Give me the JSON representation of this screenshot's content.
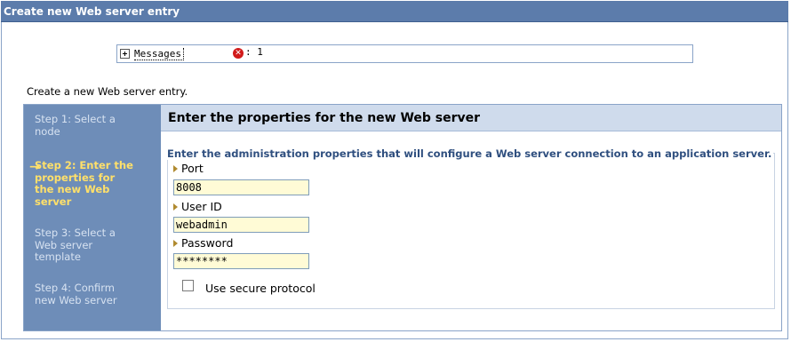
{
  "window": {
    "title": "Create new Web server entry"
  },
  "messages": {
    "label": "Messages",
    "error_count": ": 1",
    "error_icon": "error-x-icon"
  },
  "intro_text": "Create a new Web server entry.",
  "steps": [
    {
      "label": "Step 1: Select a node",
      "current": false
    },
    {
      "label": "Step 2: Enter the properties for the new Web server",
      "current": true
    },
    {
      "label": "Step 3: Select a Web server template",
      "current": false
    },
    {
      "label": "Step 4: Confirm new Web server",
      "current": false
    }
  ],
  "current_step_marker": "→",
  "content": {
    "heading": "Enter the properties for the new Web server",
    "legend": "Enter the administration properties that will configure a Web server connection to an application server.",
    "fields": {
      "port": {
        "label": "Port",
        "value": "8008"
      },
      "user_id": {
        "label": "User ID",
        "value": "webadmin"
      },
      "password": {
        "label": "Password",
        "value": "********"
      }
    },
    "secure_protocol": {
      "label": "Use secure protocol",
      "checked": false
    }
  },
  "colors": {
    "titlebar": "#5c7cab",
    "steps_panel": "#6e8db8",
    "current_step": "#ffe06a",
    "content_header": "#cfdbec",
    "input_bg": "#fffbd6",
    "legend_text": "#2f4f7f"
  }
}
